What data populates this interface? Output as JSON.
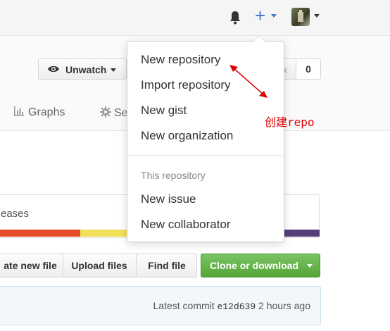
{
  "header": {
    "notifications_icon": "bell-icon",
    "create_icon": "plus-icon",
    "avatar_icon": "user-avatar"
  },
  "repohead": {
    "watch_button_label": "Unwatch",
    "fork_tail": "k",
    "fork_count": "0",
    "tabs": [
      {
        "label": "Graphs",
        "icon": "graph-icon"
      },
      {
        "label": "Se",
        "icon": "gear-icon"
      }
    ]
  },
  "dropdown": {
    "items": [
      {
        "label": "New repository"
      },
      {
        "label": "Import repository"
      },
      {
        "label": "New gist"
      },
      {
        "label": "New organization"
      }
    ],
    "section_header": "This repository",
    "section_items": [
      {
        "label": "New issue"
      },
      {
        "label": "New collaborator"
      }
    ]
  },
  "releases_box": {
    "label": "eases",
    "language_colors": [
      "#e34c26",
      "#f1e05a",
      "#563d7c"
    ]
  },
  "file_actions": {
    "create_label": "ate new file",
    "upload_label": "Upload files",
    "find_label": "Find file",
    "clone_label": "Clone or download"
  },
  "commit": {
    "prefix": "Latest commit",
    "sha": "e12d639",
    "time": "2 hours ago"
  },
  "annotation": {
    "text": "创建repo",
    "color": "#e00000"
  }
}
